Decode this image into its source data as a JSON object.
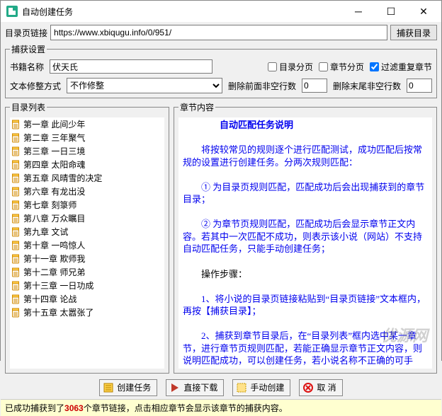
{
  "window": {
    "title": "自动创建任务"
  },
  "url_row": {
    "label": "目录页链接",
    "value": "https://www.xbiqugu.info/0/951/",
    "capture_btn": "捕获目录"
  },
  "settings": {
    "legend": "捕获设置",
    "book_label": "书籍名称",
    "book_value": "伏天氏",
    "chk_catalog_page": "目录分页",
    "chk_chapter_page": "章节分页",
    "chk_filter_dup": "过滤重复章节",
    "catalog_page_checked": false,
    "chapter_page_checked": false,
    "filter_dup_checked": true,
    "trim_label": "文本修整方式",
    "trim_value": "不作修整",
    "del_front_label": "删除前面非空行数",
    "del_front_value": "0",
    "del_tail_label": "删除末尾非空行数",
    "del_tail_value": "0"
  },
  "list": {
    "legend": "目录列表",
    "items": [
      "第一章 此间少年",
      "第二章 三年聚气",
      "第三章 一日三境",
      "第四章 太阳命魂",
      "第五章 风晴雪的决定",
      "第六章 有龙出没",
      "第七章 刻箓师",
      "第八章 万众瞩目",
      "第九章 文试",
      "第十章 一鸣惊人",
      "第十一章 欺师我",
      "第十二章 师兄弟",
      "第十三章 一日功成",
      "第十四章 论战",
      "第十五章 太嚣张了"
    ]
  },
  "content": {
    "legend": "章节内容",
    "title": "自动匹配任务说明",
    "p1a": "将按较常见的规则逐个进行匹配测试，成功匹配后按常规的设置进行创建任务。分两次规则匹配：",
    "p2a": "① 为目录页规则匹配，匹配成功后会出现捕获到的章节目录；",
    "p3a": "② 为章节页规则匹配，匹配成功后会显示章节正文内容。若其中一次匹配不成功，则表示该小说（网站）不支持自动匹配任务，只能手动创建任务；",
    "steps_label": "操作步骤：",
    "s1": "1、将小说的目录页链接粘贴到“目录页链接”文本框内，再按【捕获目录】；",
    "s2": "2、捕获到章节目录后，在“目录列表”框内选中某一章节，进行章节页规则匹配，若能正确显示章节正文内容，则说明匹配成功，可以创建任务，若小说名称不正确的可手"
  },
  "buttons": {
    "create": "创建任务",
    "direct": "直接下载",
    "manual": "手动创建",
    "cancel": "取 消"
  },
  "status": {
    "pre": "已成功捕获到了",
    "count": "3063",
    "post": "个章节链接，点击相应章节会显示该章节的捕获内容。"
  },
  "watermark": "优源网"
}
